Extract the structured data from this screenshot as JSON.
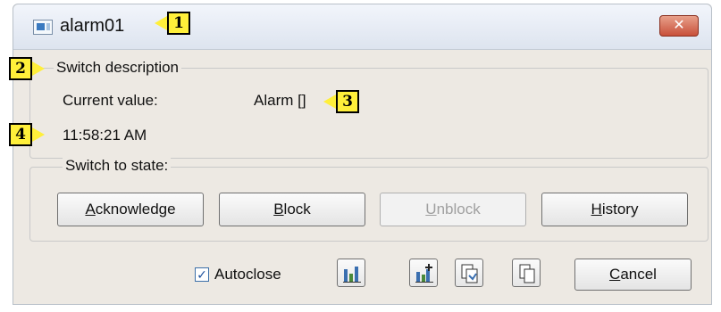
{
  "window": {
    "title": "alarm01",
    "close_glyph": "✕"
  },
  "callouts": [
    "1",
    "2",
    "3",
    "4"
  ],
  "switch_description": {
    "legend": "Switch description",
    "current_value_label": "Current value:",
    "current_value": "Alarm []",
    "timestamp": "11:58:21 AM"
  },
  "switch_to_state": {
    "legend": "Switch to state:",
    "buttons": [
      {
        "first": "A",
        "rest": "cknowledge",
        "enabled": true
      },
      {
        "first": "B",
        "rest": "lock",
        "enabled": true
      },
      {
        "first": "U",
        "rest": "nblock",
        "enabled": false
      },
      {
        "first": "H",
        "rest": "istory",
        "enabled": true
      }
    ]
  },
  "footer": {
    "autoclose_label": "Autoclose",
    "autoclose_checked": true,
    "checkmark": "✓",
    "icons": [
      "bar-chart-icon",
      "bar-chart-add-icon",
      "copy-document-icon",
      "copy-pages-icon"
    ],
    "cancel": {
      "first": "C",
      "rest": "ancel"
    }
  },
  "colors": {
    "callout": "#ffef3a",
    "close_button": "#c8503a",
    "dialog_background": "#ede9e3"
  }
}
